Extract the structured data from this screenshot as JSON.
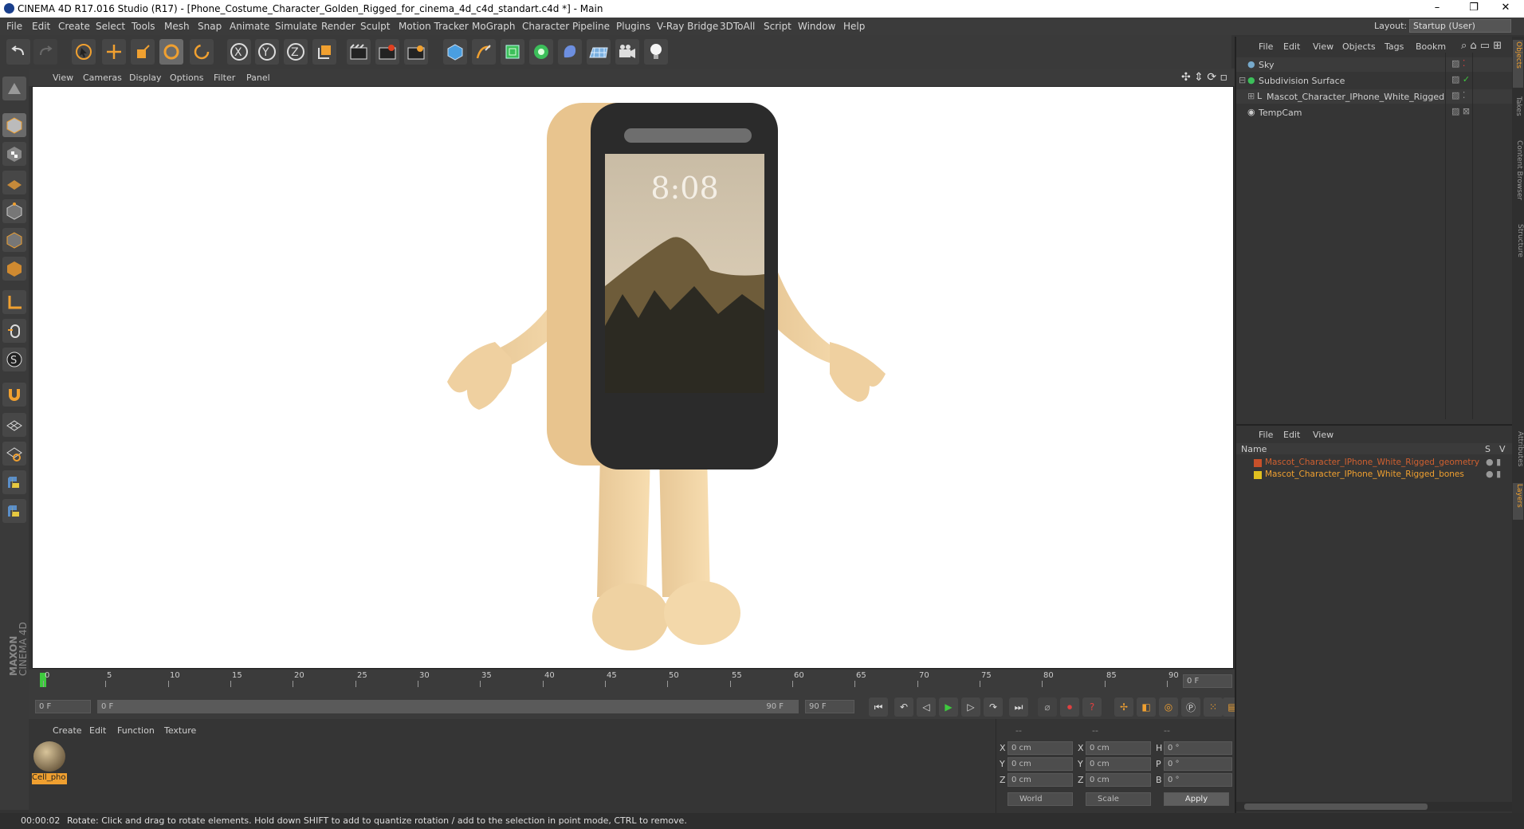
{
  "window": {
    "title": "CINEMA 4D R17.016 Studio (R17) - [Phone_Costume_Character_Golden_Rigged_for_cinema_4d_c4d_standart.c4d *] - Main",
    "minimize": "–",
    "restore": "❐",
    "close": "✕"
  },
  "menu": [
    "File",
    "Edit",
    "Create",
    "Select",
    "Tools",
    "Mesh",
    "Snap",
    "Animate",
    "Simulate",
    "Render",
    "Sculpt",
    "Motion Tracker",
    "MoGraph",
    "Character",
    "Pipeline",
    "Plugins",
    "V-Ray Bridge",
    "3DToAll",
    "Script",
    "Window",
    "Help"
  ],
  "layout": {
    "label": "Layout:",
    "value": "Startup (User)"
  },
  "viewport_menu": [
    "View",
    "Cameras",
    "Display",
    "Options",
    "Filter",
    "Panel"
  ],
  "screen": {
    "time": "8:08"
  },
  "timeline": {
    "ticks": [
      "0",
      "5",
      "10",
      "15",
      "20",
      "25",
      "30",
      "35",
      "40",
      "45",
      "50",
      "55",
      "60",
      "65",
      "70",
      "75",
      "80",
      "85",
      "90"
    ],
    "current_frame": "0 F",
    "start_field": "0 F",
    "range_start": "0 F",
    "range_end": "90 F",
    "end_field": "90 F"
  },
  "material_menu": [
    "Create",
    "Edit",
    "Function",
    "Texture"
  ],
  "material": {
    "name": "Cell_pho"
  },
  "coords": {
    "header": [
      "--",
      "--",
      "--"
    ],
    "rows": [
      {
        "a": "X",
        "v1": "0 cm",
        "b": "X",
        "v2": "0 cm",
        "c": "H",
        "v3": "0 °"
      },
      {
        "a": "Y",
        "v1": "0 cm",
        "b": "Y",
        "v2": "0 cm",
        "c": "P",
        "v3": "0 °"
      },
      {
        "a": "Z",
        "v1": "0 cm",
        "b": "Z",
        "v2": "0 cm",
        "c": "B",
        "v3": "0 °"
      }
    ],
    "world": "World",
    "scale": "Scale",
    "apply": "Apply"
  },
  "object_manager": {
    "menu": [
      "File",
      "Edit",
      "View",
      "Objects",
      "Tags",
      "Bookm"
    ],
    "objects": [
      "Sky",
      "Subdivision Surface",
      "Mascot_Character_IPhone_White_Rigged",
      "TempCam"
    ]
  },
  "layer_manager": {
    "menu": [
      "File",
      "Edit",
      "View"
    ],
    "col_name": "Name",
    "col_s": "S",
    "col_v": "V",
    "layers": [
      {
        "name": "Mascot_Character_IPhone_White_Rigged_geometry",
        "color": "#c8502a"
      },
      {
        "name": "Mascot_Character_IPhone_White_Rigged_bones",
        "color": "#e0c020"
      }
    ]
  },
  "side_tabs": [
    "Objects",
    "Takes",
    "Content Browser",
    "Structure",
    "Attributes",
    "Layers"
  ],
  "brand": {
    "line1": "MAXON",
    "line2": "CINEMA 4D"
  },
  "status": {
    "time": "00:00:02",
    "message": "Rotate: Click and drag to rotate elements. Hold down SHIFT to add to quantize rotation / add to the selection in point mode, CTRL to remove."
  },
  "colors": {
    "accent": "#f0a030",
    "bg": "#333333",
    "play": "#3ec93e"
  }
}
